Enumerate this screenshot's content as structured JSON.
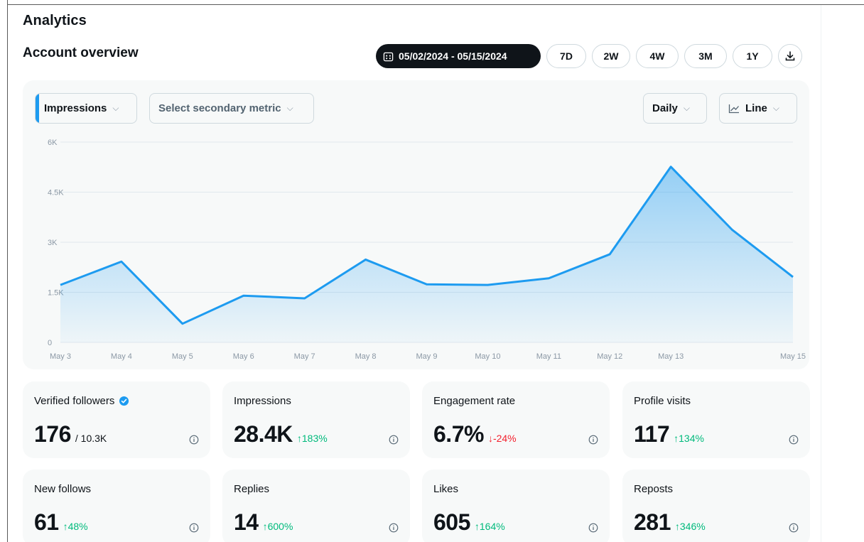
{
  "header": {
    "title": "Analytics",
    "subtitle": "Account overview"
  },
  "range": {
    "date_label": "05/02/2024 - 05/15/2024",
    "options": [
      "7D",
      "2W",
      "4W",
      "3M",
      "1Y"
    ]
  },
  "controls": {
    "primary_metric": "Impressions",
    "secondary_metric_placeholder": "Select secondary metric",
    "interval": "Daily",
    "chart_type": "Line"
  },
  "colors": {
    "accent": "#1d9bf0",
    "positive": "#00ba7c",
    "negative": "#f4212e"
  },
  "chart_data": {
    "type": "area",
    "x": [
      "May 3",
      "May 4",
      "May 5",
      "May 6",
      "May 7",
      "May 8",
      "May 9",
      "May 10",
      "May 11",
      "May 12",
      "May 13",
      "May 14",
      "May 15"
    ],
    "x_tick_labels": [
      "May 3",
      "May 4",
      "May 5",
      "May 6",
      "May 7",
      "May 8",
      "May 9",
      "May 10",
      "May 11",
      "May 12",
      "May 13",
      "May 15"
    ],
    "series": [
      {
        "values": [
          1720,
          2420,
          560,
          1400,
          1320,
          2480,
          1740,
          1720,
          1920,
          2640,
          5260,
          3380,
          1960
        ]
      }
    ],
    "y_ticks": [
      "0",
      "1.5K",
      "3K",
      "4.5K",
      "6K"
    ],
    "ylim": [
      0,
      6000
    ],
    "grid": true,
    "legend": "none"
  },
  "stats": [
    {
      "label": "Verified followers",
      "value": "176",
      "suffix": "/ 10.3K",
      "delta": "",
      "verified": true
    },
    {
      "label": "Impressions",
      "value": "28.4K",
      "suffix": "",
      "delta": "↑183%",
      "direction": "up"
    },
    {
      "label": "Engagement rate",
      "value": "6.7%",
      "suffix": "",
      "delta": "↓-24%",
      "direction": "down"
    },
    {
      "label": "Profile visits",
      "value": "117",
      "suffix": "",
      "delta": "↑134%",
      "direction": "up"
    },
    {
      "label": "New follows",
      "value": "61",
      "suffix": "",
      "delta": "↑48%",
      "direction": "up"
    },
    {
      "label": "Replies",
      "value": "14",
      "suffix": "",
      "delta": "↑600%",
      "direction": "up"
    },
    {
      "label": "Likes",
      "value": "605",
      "suffix": "",
      "delta": "↑164%",
      "direction": "up"
    },
    {
      "label": "Reposts",
      "value": "281",
      "suffix": "",
      "delta": "↑346%",
      "direction": "up"
    }
  ],
  "icons": {
    "calendar": "calendar-icon",
    "download": "download-icon",
    "chevron": "chevron-down-icon",
    "line_chart": "line-chart-icon",
    "info": "info-icon",
    "verified": "verified-badge-icon"
  }
}
